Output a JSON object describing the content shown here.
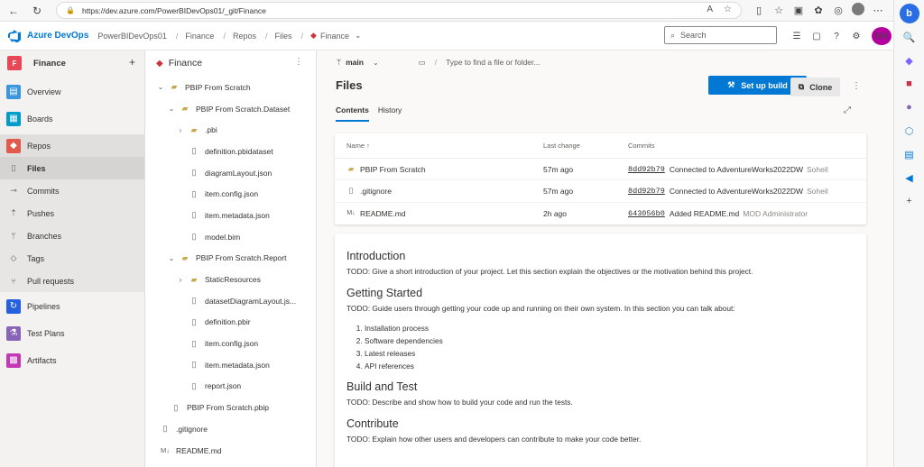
{
  "browser": {
    "url": "https://dev.azure.com/PowerBIDevOps01/_git/Finance"
  },
  "header": {
    "brand": "Azure DevOps",
    "org": "PowerBIDevOps01",
    "crumbs": [
      "Finance",
      "Repos",
      "Files"
    ],
    "repo_crumb": "Finance",
    "search_placeholder": "Search",
    "avatar_initials": "MA"
  },
  "project": {
    "badge": "F",
    "name": "Finance"
  },
  "nav": {
    "overview": "Overview",
    "boards": "Boards",
    "repos": "Repos",
    "files": "Files",
    "commits": "Commits",
    "pushes": "Pushes",
    "branches": "Branches",
    "tags": "Tags",
    "pull_requests": "Pull requests",
    "pipelines": "Pipelines",
    "test_plans": "Test Plans",
    "artifacts": "Artifacts"
  },
  "tree": {
    "repo": "Finance",
    "items": [
      "PBIP From Scratch",
      "PBIP From Scratch.Dataset",
      ".pbi",
      "definition.pbidataset",
      "diagramLayout.json",
      "item.config.json",
      "item.metadata.json",
      "model.bim",
      "PBIP From Scratch.Report",
      "StaticResources",
      "datasetDiagramLayout.js...",
      "definition.pbir",
      "item.config.json",
      "item.metadata.json",
      "report.json",
      "PBIP From Scratch.pbip",
      ".gitignore",
      "README.md"
    ]
  },
  "main": {
    "branch": "main",
    "path_placeholder": "Type to find a file or folder...",
    "title": "Files",
    "setup_build": "Set up build",
    "clone": "Clone",
    "tabs": [
      "Contents",
      "History"
    ],
    "columns": [
      "Name ↑",
      "Last change",
      "Commits"
    ],
    "files": [
      {
        "name": "PBIP From Scratch",
        "change": "57m ago",
        "hash": "8dd92b79",
        "message": "Connected to AdventureWorks2022DW",
        "author": "Soheil"
      },
      {
        "name": ".gitignore",
        "change": "57m ago",
        "hash": "8dd92b79",
        "message": "Connected to AdventureWorks2022DW",
        "author": "Soheil"
      },
      {
        "name": "README.md",
        "change": "2h ago",
        "hash": "643056b0",
        "message": "Added README.md",
        "author": "MOD Administrator"
      }
    ]
  },
  "readme": {
    "intro_h": "Introduction",
    "intro_p": "TODO: Give a short introduction of your project. Let this section explain the objectives or the motivation behind this project.",
    "gs_h": "Getting Started",
    "gs_p": "TODO: Guide users through getting your code up and running on their own system. In this section you can talk about:",
    "gs_list": [
      "Installation process",
      "Software dependencies",
      "Latest releases",
      "API references"
    ],
    "bt_h": "Build and Test",
    "bt_p": "TODO: Describe and show how to build your code and run the tests.",
    "c_h": "Contribute",
    "c_p": "TODO: Explain how other users and developers can contribute to make your code better."
  }
}
